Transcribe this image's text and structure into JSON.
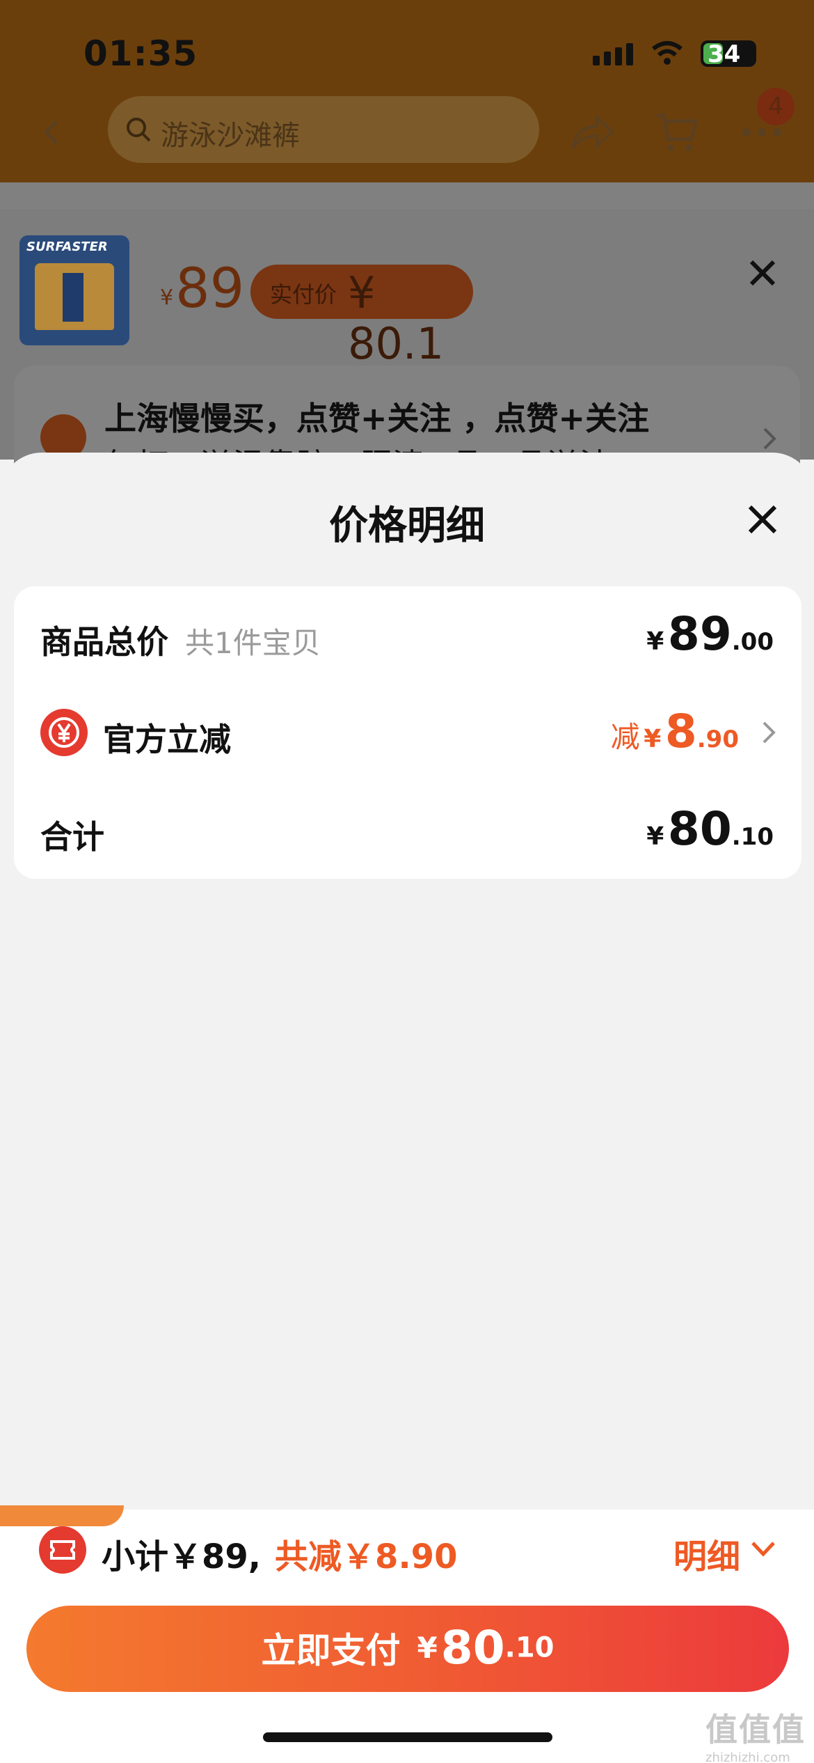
{
  "status_bar": {
    "time": "01:35",
    "battery": "34"
  },
  "background_page": {
    "search_placeholder": "游泳沙滩裤",
    "cart_badge": "4",
    "product": {
      "thumb_brand": "SURFASTER",
      "price_symbol": "¥",
      "price": "89",
      "real_pay_label": "实付价",
      "real_pay_value": "¥ 80.1"
    },
    "address_line1": "上海慢慢买，点赞+关注 ，点赞+关注",
    "address_line2": "年打，溢温靠踪，照清+品，品溢沽"
  },
  "sheet": {
    "title": "价格明细",
    "total_row": {
      "label": "商品总价",
      "sub": "共1件宝贝",
      "yen": "¥",
      "int": "89",
      "dec": ".00"
    },
    "discount_row": {
      "label": "官方立减",
      "prefix": "减",
      "yen": "¥",
      "int": "8",
      "dec": ".90"
    },
    "sum_row": {
      "label": "合计",
      "yen": "¥",
      "int": "80",
      "dec": ".10"
    }
  },
  "bottom_bar": {
    "subtotal": "小计￥89,",
    "saved": "共减￥8.90",
    "detail_label": "明细",
    "pay_label": "立即支付",
    "pay_yen": "¥",
    "pay_int": "80",
    "pay_dec": ".10"
  },
  "watermark": {
    "logo": "值值值",
    "url": "zhizhizhi.com"
  },
  "colors": {
    "accent": "#ee5a24",
    "pay_start": "#f47a2e",
    "pay_end": "#ec3a3c",
    "icon_red": "#e53a2f"
  }
}
